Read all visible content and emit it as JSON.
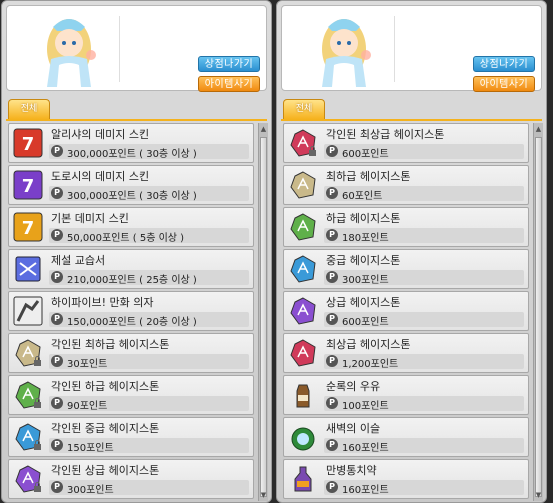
{
  "left": {
    "buttons": {
      "exit": "상점나가기",
      "buy": "아이템사기"
    },
    "tab": "전체",
    "items": [
      {
        "name": "알리샤의 데미지 스킨",
        "price": "300,000포인트 ( 30층 이상 )",
        "icon": "damage-skin-alicia-icon",
        "color": "#d83a2a"
      },
      {
        "name": "도로시의 데미지 스킨",
        "price": "300,000포인트 ( 30층 이상 )",
        "icon": "damage-skin-dorothy-icon",
        "color": "#7a3fc9"
      },
      {
        "name": "기본 데미지 스킨",
        "price": "50,000포인트 ( 5층 이상 )",
        "icon": "damage-skin-basic-icon",
        "color": "#e8a21a"
      },
      {
        "name": "제설 교습서",
        "price": "210,000포인트 ( 25층 이상 )",
        "icon": "skill-book-icon",
        "color": "#5b6de0"
      },
      {
        "name": "하이파이브! 만화 의자",
        "price": "150,000포인트 ( 20층 이상 )",
        "icon": "comic-chair-icon",
        "color": "#444444"
      },
      {
        "name": "각인된 최하급 헤이지스톤",
        "price": "30포인트",
        "icon": "hazestone-lowest-icon",
        "color": "#c9b98a",
        "locked": true
      },
      {
        "name": "각인된 하급 헤이지스톤",
        "price": "90포인트",
        "icon": "hazestone-low-icon",
        "color": "#5fb04a",
        "locked": true
      },
      {
        "name": "각인된 중급 헤이지스톤",
        "price": "150포인트",
        "icon": "hazestone-mid-icon",
        "color": "#3a9ad8",
        "locked": true
      },
      {
        "name": "각인된 상급 헤이지스톤",
        "price": "300포인트",
        "icon": "hazestone-high-icon",
        "color": "#8a4fd0",
        "locked": true
      }
    ]
  },
  "right": {
    "buttons": {
      "exit": "상점나가기",
      "buy": "아이템사기"
    },
    "tab": "전체",
    "items": [
      {
        "name": "각인된 최상급 헤이지스톤",
        "price": "600포인트",
        "icon": "hazestone-highest-icon",
        "color": "#d03a5a",
        "locked": true
      },
      {
        "name": "최하급 헤이지스톤",
        "price": "60포인트",
        "icon": "hazestone-lowest-icon",
        "color": "#c9b98a"
      },
      {
        "name": "하급 헤이지스톤",
        "price": "180포인트",
        "icon": "hazestone-low-icon",
        "color": "#5fb04a"
      },
      {
        "name": "중급 헤이지스톤",
        "price": "300포인트",
        "icon": "hazestone-mid-icon",
        "color": "#3a9ad8"
      },
      {
        "name": "상급 헤이지스톤",
        "price": "600포인트",
        "icon": "hazestone-high-icon",
        "color": "#8a4fd0"
      },
      {
        "name": "최상급 헤이지스톤",
        "price": "1,200포인트",
        "icon": "hazestone-highest-icon",
        "color": "#d03a5a"
      },
      {
        "name": "순록의 우유",
        "price": "100포인트",
        "icon": "reindeer-milk-icon",
        "color": "#8a5a2a"
      },
      {
        "name": "새벽의 이슬",
        "price": "160포인트",
        "icon": "dawn-dew-icon",
        "color": "#2e8a3a"
      },
      {
        "name": "만병통치약",
        "price": "160포인트",
        "icon": "elixir-icon",
        "color": "#7a4ab0"
      }
    ]
  }
}
